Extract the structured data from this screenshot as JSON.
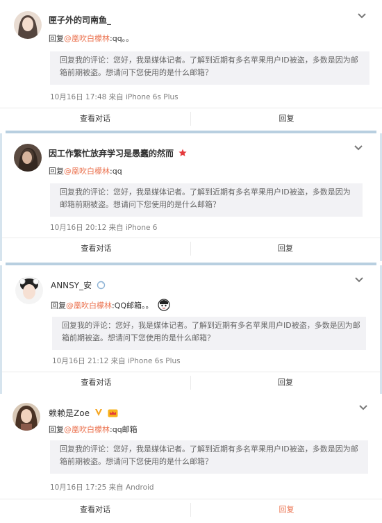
{
  "comments": [
    {
      "username": "匣子外的司南鱼_",
      "reply_prefix": "回复",
      "mention": "@凰吹白檬林",
      "reply_text": ":qq。。",
      "quote": "回复我的评论：您好，我是媒体记者。了解到近期有多名苹果用户ID被盗，多数是因为邮箱前期被盗。想请问下您使用的是什么邮箱？",
      "meta": "10月16日 17:48 来自 iPhone 6s Plus",
      "view_conversation": "查看对话",
      "reply_button": "回复"
    },
    {
      "username": "因工作繁忙放弃学习是愚蠢的然而",
      "reply_prefix": "回复",
      "mention": "@凰吹白檬林",
      "reply_text": ":qq",
      "quote": "回复我的评论：您好，我是媒体记者。了解到近期有多名苹果用户ID被盗，多数是因为邮箱前期被盗。想请问下您使用的是什么邮箱？",
      "meta": "10月16日 20:12 来自 iPhone 6",
      "view_conversation": "查看对话",
      "reply_button": "回复"
    },
    {
      "username": "ANNSY_安",
      "reply_prefix": "回复",
      "mention": "@凰吹白檬林",
      "reply_text": ":QQ邮箱。。",
      "quote": "回复我的评论：您好，我是媒体记者。了解到近期有多名苹果用户ID被盗，多数是因为邮箱前期被盗。想请问下您使用的是什么邮箱？",
      "meta": "10月16日 21:12 来自 iPhone 6s Plus",
      "view_conversation": "查看对话",
      "reply_button": "回复"
    },
    {
      "username": "赖赖是Zoe",
      "reply_prefix": "回复",
      "mention": "@凰吹白檬林",
      "reply_text": ":qq邮箱",
      "quote": "回复我的评论：您好，我是媒体记者。了解到近期有多名苹果用户ID被盗，多数是因为邮箱前期被盗。想请问下您使用的是什么邮箱？",
      "meta": "10月16日 17:25 来自 Android",
      "view_conversation": "查看对话",
      "reply_button": "回复"
    }
  ],
  "colors": {
    "mention": "#eb7350",
    "separator": "#b8cfe0",
    "quote_bg": "#f2f2f5",
    "meta": "#808080"
  },
  "icons": [
    "avatar",
    "chevron-down-icon",
    "star-icon",
    "refresh-badge-icon",
    "emoji-icon",
    "verified-v-icon",
    "vip-crown-icon"
  ]
}
